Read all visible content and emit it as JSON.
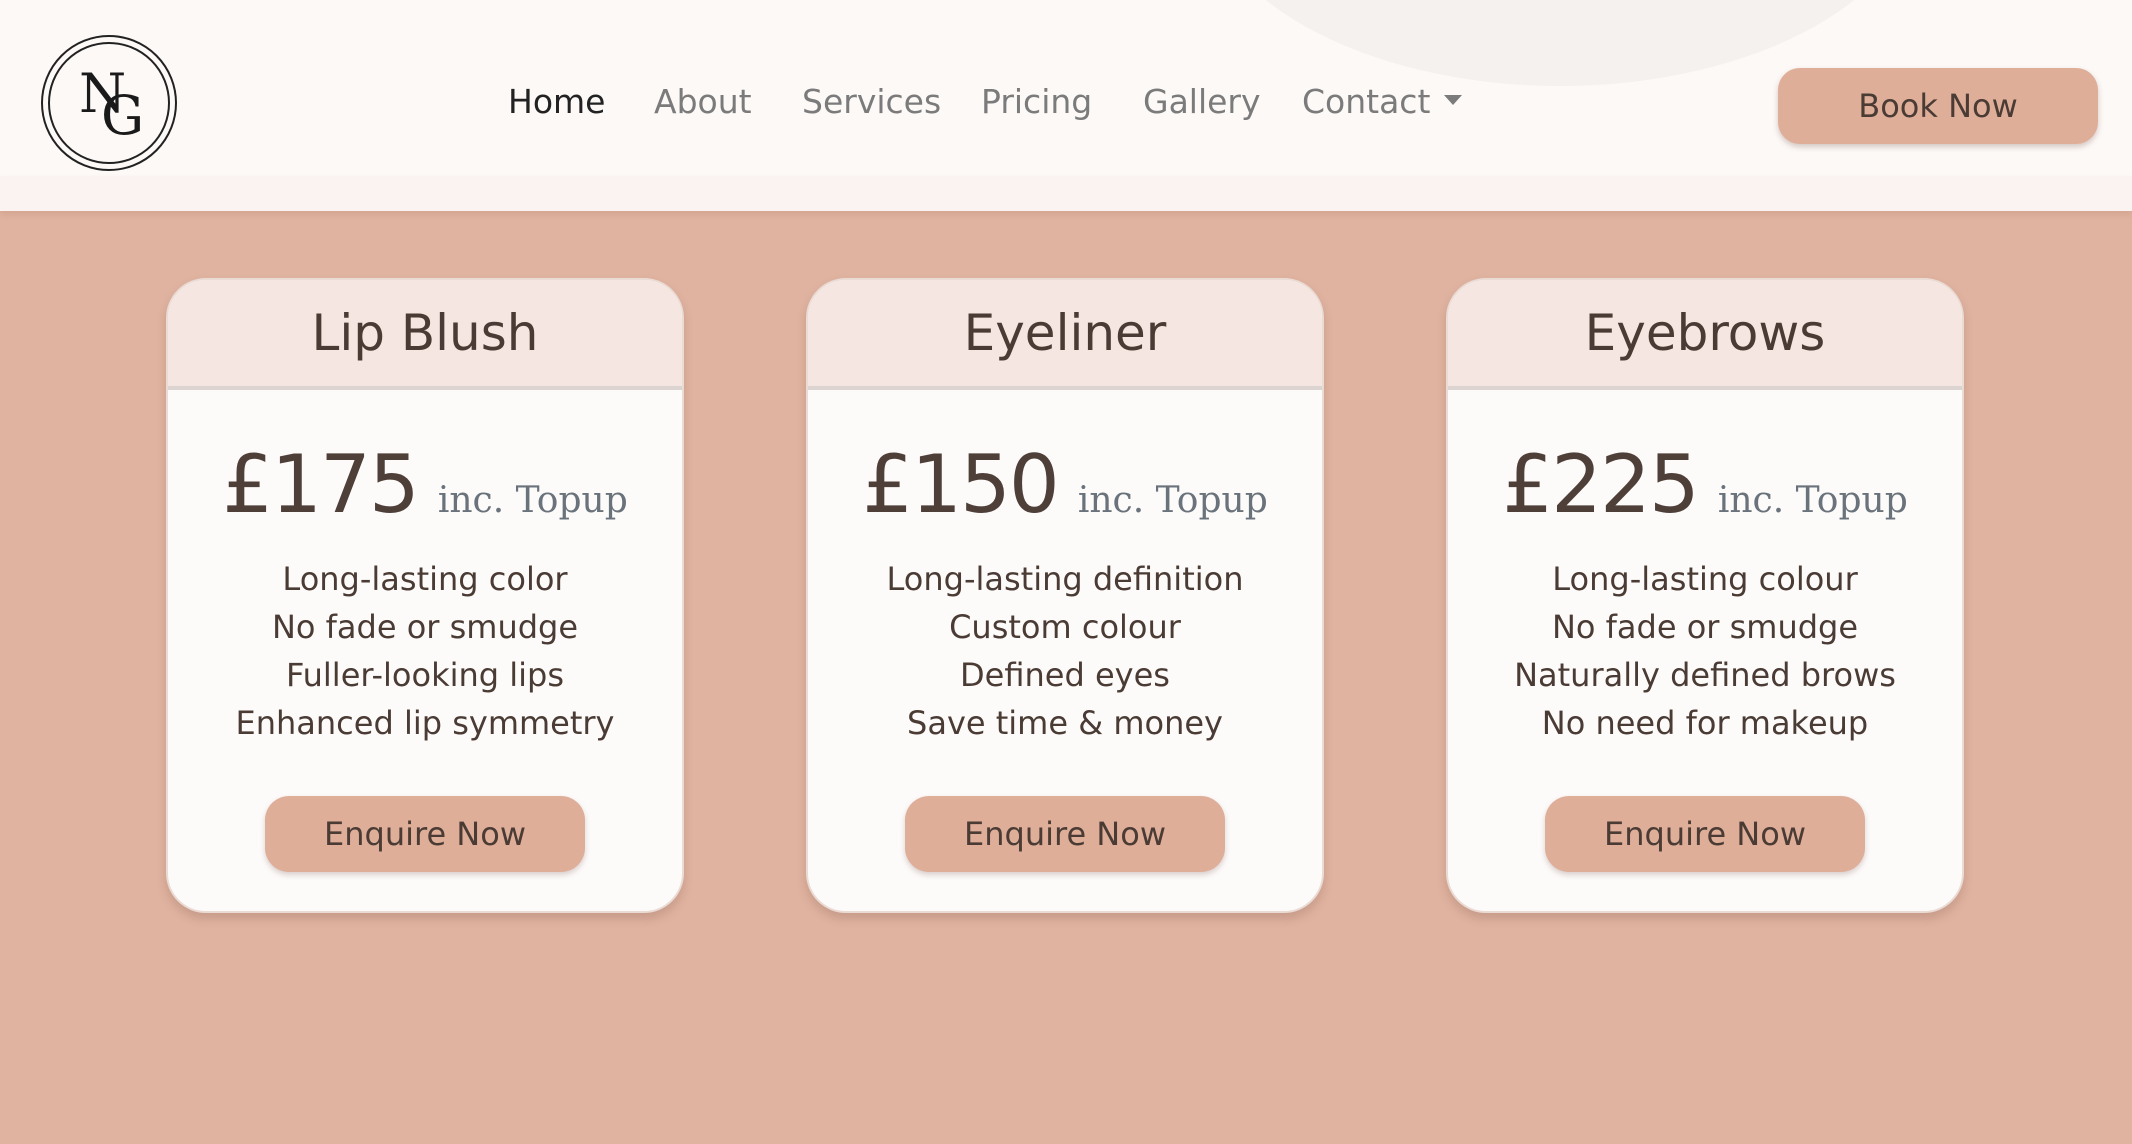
{
  "header": {
    "logo_letters": [
      "N",
      "G"
    ],
    "nav": [
      {
        "label": "Home",
        "active": true
      },
      {
        "label": "About",
        "active": false
      },
      {
        "label": "Services",
        "active": false
      },
      {
        "label": "Pricing",
        "active": false
      },
      {
        "label": "Gallery",
        "active": false
      },
      {
        "label": "Contact",
        "active": false,
        "dropdown": true
      }
    ],
    "book_button": "Book Now"
  },
  "cards": [
    {
      "title": "Lip Blush",
      "price": "£175",
      "note": "inc. Topup",
      "features": [
        "Long-lasting color",
        "No fade or smudge",
        "Fuller-looking lips",
        "Enhanced lip symmetry"
      ],
      "button": "Enquire Now"
    },
    {
      "title": "Eyeliner",
      "price": "£150",
      "note": "inc. Topup",
      "features": [
        "Long-lasting definition",
        "Custom colour",
        "Defined eyes",
        "Save time & money"
      ],
      "button": "Enquire Now"
    },
    {
      "title": "Eyebrows",
      "price": "£225",
      "note": "inc. Topup",
      "features": [
        "Long-lasting colour",
        "No fade or smudge",
        "Naturally defined brows",
        "No need for makeup"
      ],
      "button": "Enquire Now"
    }
  ],
  "colors": {
    "background": "#e0b3a0",
    "header": "#fdf9f7",
    "button": "#dfae99",
    "card_head": "#f5e6e1",
    "text": "#4a3b34"
  }
}
